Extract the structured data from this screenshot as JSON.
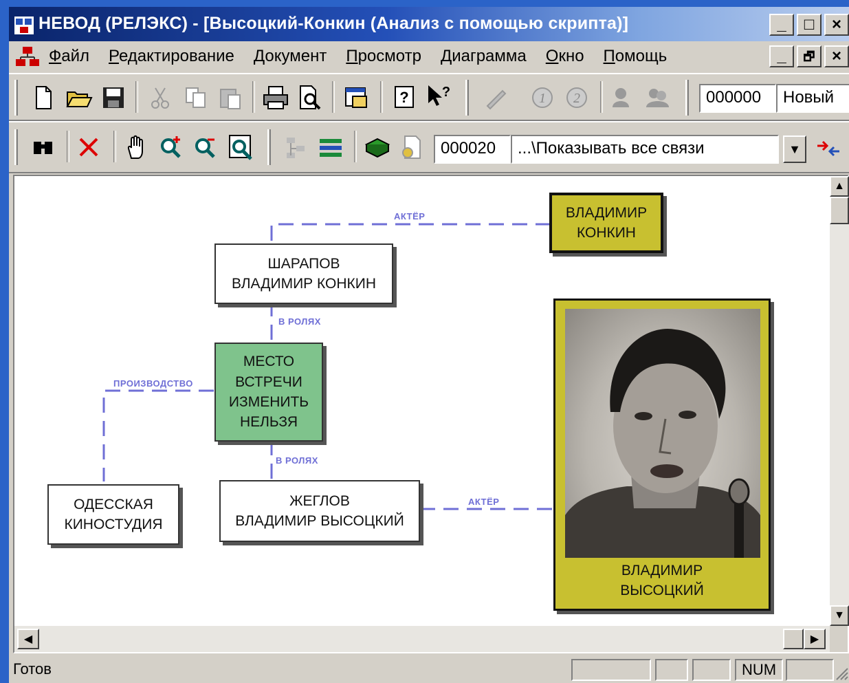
{
  "window": {
    "title": "НЕВОД (РЕЛЭКС) - [Высоцкий-Конкин (Анализ с помощью скрипта)]",
    "buttons": {
      "minimize": "_",
      "maximize": "□",
      "close": "×",
      "restore": "🗗"
    }
  },
  "menu": {
    "items": [
      "Файл",
      "Редактирование",
      "Документ",
      "Просмотр",
      "Диаграмма",
      "Окно",
      "Помощь"
    ]
  },
  "toolbar1": {
    "doc_number": "000000",
    "doc_status": "Новый"
  },
  "toolbar2": {
    "link_number": "000020",
    "link_filter": "...\\Показывать все связи",
    "dropdown_arrow": "▼"
  },
  "diagram": {
    "nodes": {
      "konkin_person": "ВЛАДИМИР\nКОНКИН",
      "sharapov_role": "ШАРАПОВ\nВЛАДИМИР КОНКИН",
      "film": "МЕСТО\nВСТРЕЧИ\nИЗМЕНИТЬ\nНЕЛЬЗЯ",
      "studio": "ОДЕССКАЯ\nКИНОСТУДИЯ",
      "zheglov_role": "ЖЕГЛОВ\nВЛАДИМИР ВЫСОЦКИЙ",
      "vysotsky_person": "ВЛАДИМИР\nВЫСОЦКИЙ"
    },
    "links": {
      "actor_top": "АКТЁР",
      "role_top": "В РОЛЯХ",
      "production": "ПРОИЗВОДСТВО",
      "role_bottom": "В РОЛЯХ",
      "actor_bottom": "АКТЁР"
    },
    "colors": {
      "film": "#7fc38c",
      "person": "#c8c030",
      "link": "#6f6fd6"
    }
  },
  "statusbar": {
    "text": "Готов",
    "num": "NUM"
  }
}
